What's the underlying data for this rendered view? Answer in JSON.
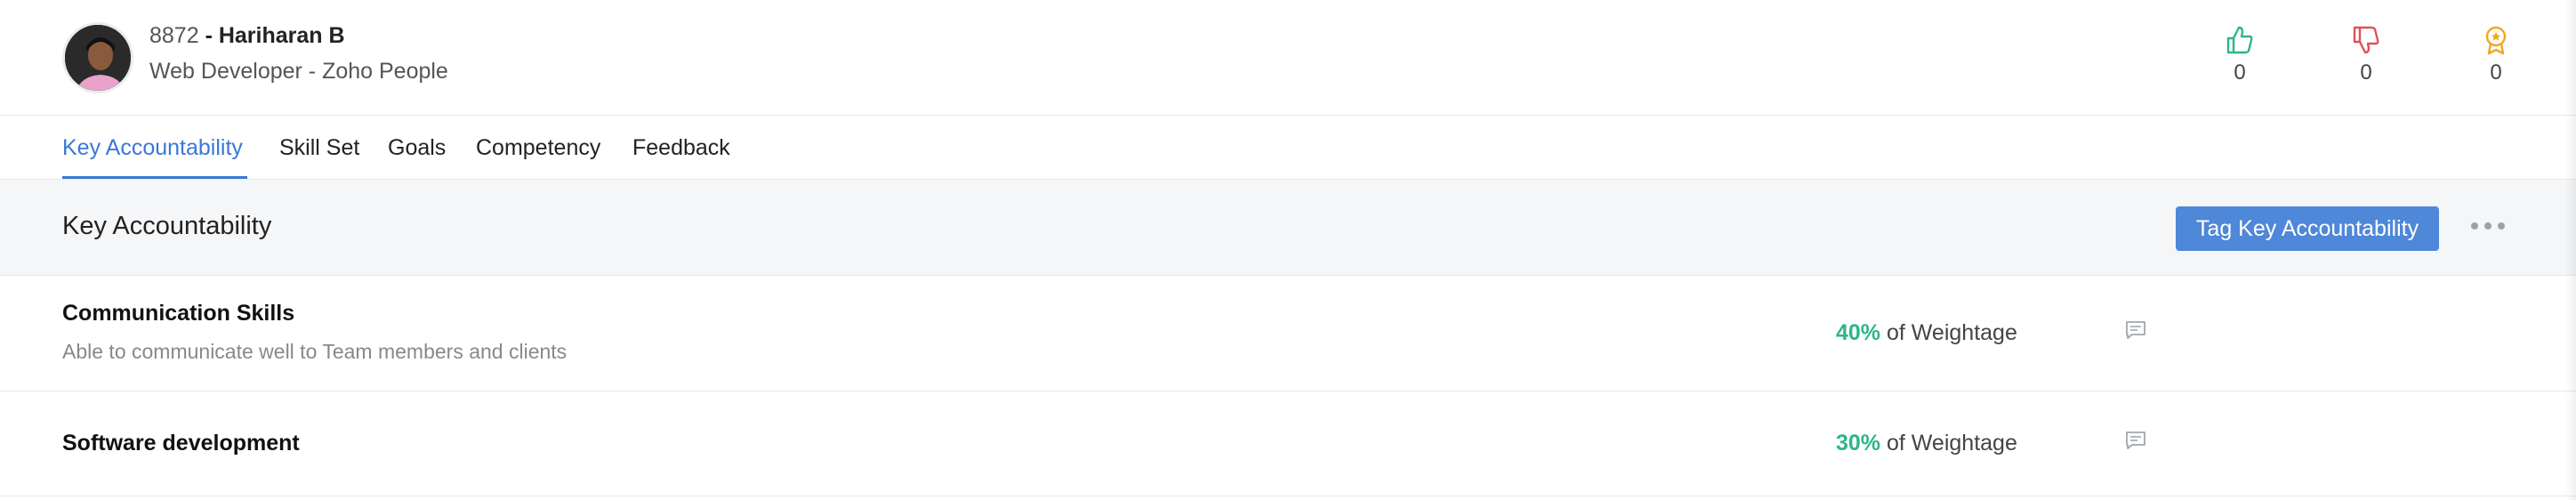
{
  "employee": {
    "id": "8872",
    "separator": " - ",
    "name": "Hariharan B",
    "designation": "Web Developer - Zoho People"
  },
  "stats": {
    "likes": "0",
    "dislikes": "0",
    "awards": "0"
  },
  "tabs": [
    {
      "label": "Key Accountability",
      "active": true
    },
    {
      "label": "Skill Set",
      "active": false
    },
    {
      "label": "Goals",
      "active": false
    },
    {
      "label": "Competency",
      "active": false
    },
    {
      "label": "Feedback",
      "active": false
    }
  ],
  "section": {
    "title": "Key Accountability",
    "primary_button": "Tag Key Accountability"
  },
  "accountabilities": [
    {
      "title": "Communication Skills",
      "description": "Able to communicate well to Team members and clients",
      "weightage": "40%",
      "weightage_suffix": " of Weightage"
    },
    {
      "title": "Software development",
      "description": "",
      "weightage": "30%",
      "weightage_suffix": " of Weightage"
    }
  ],
  "colors": {
    "accent": "#3a78d6",
    "button": "#4f87d9",
    "like": "#2eb58a",
    "dislike": "#e2505a",
    "award": "#f0a81c"
  },
  "icons": {
    "like": "thumbs-up-icon",
    "dislike": "thumbs-down-icon",
    "award": "award-badge-icon",
    "comment": "comment-icon",
    "more": "more-horizontal-icon"
  }
}
